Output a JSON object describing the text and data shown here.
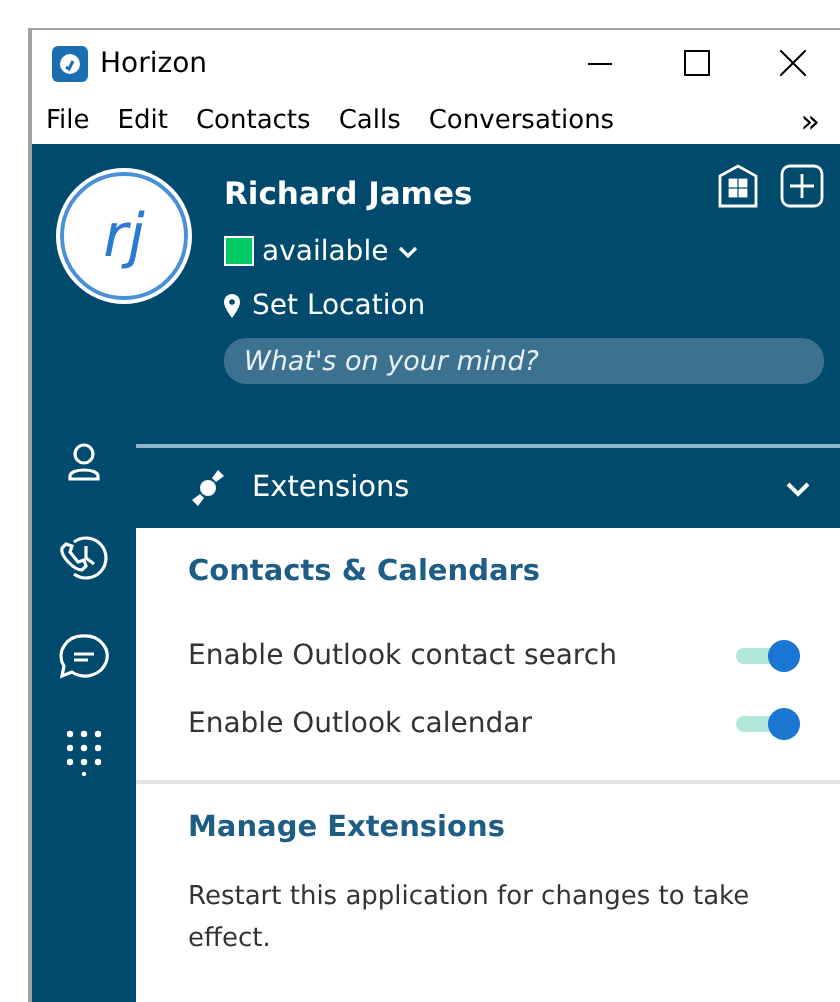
{
  "window": {
    "title": "Horizon"
  },
  "menu": {
    "items": [
      "File",
      "Edit",
      "Contacts",
      "Calls",
      "Conversations"
    ],
    "overflow": "»"
  },
  "profile": {
    "initials": "rj",
    "name": "Richard James",
    "status": "available",
    "location": "Set Location",
    "mood": {
      "placeholder": "What's on your mind?"
    }
  },
  "extensions": {
    "title": "Extensions",
    "expanded": true,
    "sections": [
      {
        "heading": "Contacts & Calendars",
        "toggles": [
          {
            "label": "Enable Outlook contact search",
            "on": true
          },
          {
            "label": "Enable Outlook calendar",
            "on": true
          }
        ]
      },
      {
        "heading": "Manage Extensions",
        "note": "Restart this application for changes to take effect."
      }
    ]
  }
}
